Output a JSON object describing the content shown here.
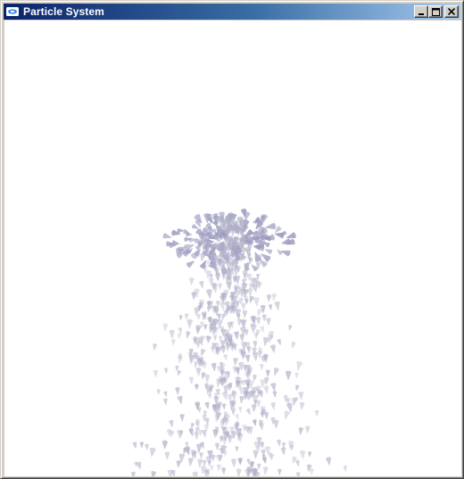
{
  "window": {
    "title": "Particle System",
    "buttons": {
      "minimize_icon": "minimize-icon",
      "maximize_icon": "maximize-icon",
      "close_icon": "close-icon"
    }
  },
  "colors": {
    "titlebar_start": "#0a246a",
    "titlebar_end": "#a6caf0",
    "canvas_background": "#ffffff",
    "particle_core": "#b0b0c8",
    "particle_dense": "#9c9cc0"
  }
}
